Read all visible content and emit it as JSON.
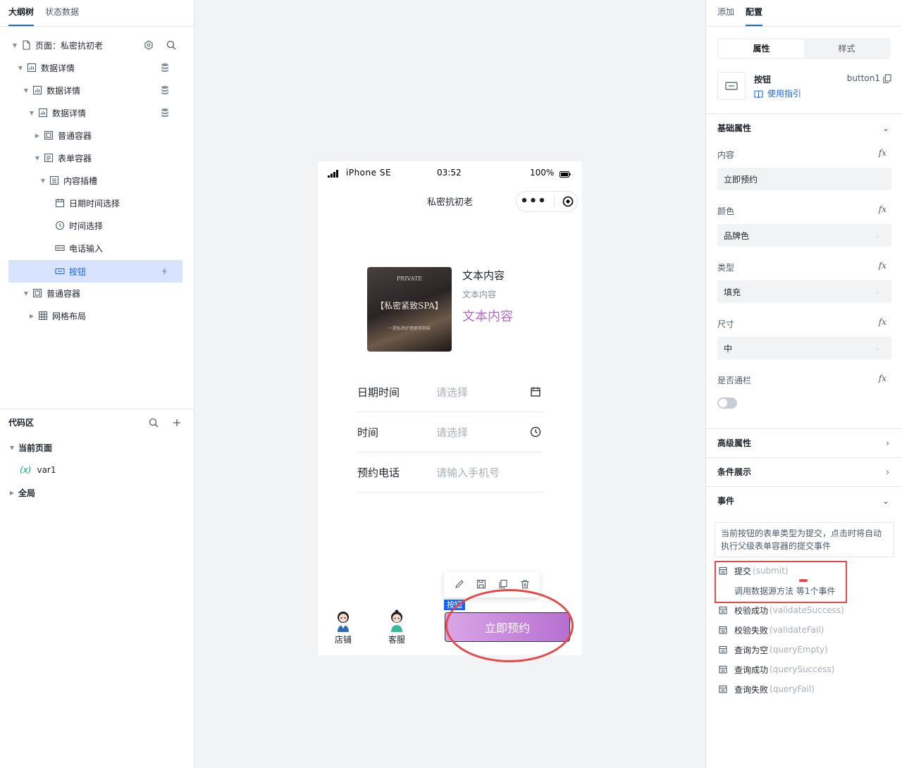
{
  "left": {
    "tabs": [
      "大纲树",
      "状态数据"
    ],
    "tree": [
      {
        "label": "页面：私密抗初老",
        "icon": "page-icon"
      },
      {
        "label": "数据详情",
        "icon": "chart-icon"
      },
      {
        "label": "数据详情",
        "icon": "chart-icon"
      },
      {
        "label": "数据详情",
        "icon": "chart-icon"
      },
      {
        "label": "普通容器",
        "icon": "container-icon"
      },
      {
        "label": "表单容器",
        "icon": "form-icon"
      },
      {
        "label": "内容插槽",
        "icon": "slot-icon"
      },
      {
        "label": "日期时间选择",
        "icon": "calendar-icon"
      },
      {
        "label": "时间选择",
        "icon": "clock-icon"
      },
      {
        "label": "电话输入",
        "icon": "input-icon"
      },
      {
        "label": "按钮",
        "icon": "button-icon"
      },
      {
        "label": "普通容器",
        "icon": "container-icon"
      },
      {
        "label": "网格布局",
        "icon": "grid-icon"
      }
    ],
    "code": {
      "title": "代码区",
      "current": "当前页面",
      "var_prefix": "(x)",
      "var": "var1",
      "global": "全局"
    }
  },
  "phone": {
    "device": "iPhone SE",
    "time": "03:52",
    "battery": "100%",
    "title": "私密抗初老",
    "image_text": "【私密紧致SPA】",
    "image_small_top": "PRIVATE",
    "image_small_sub": "一提私密护理更有韵味",
    "text1": "文本内容",
    "text2": "文本内容",
    "text3": "文本内容",
    "form": [
      {
        "label": "日期时间",
        "placeholder": "请选择",
        "icon": "calendar-icon"
      },
      {
        "label": "时间",
        "placeholder": "请选择",
        "icon": "clock-icon"
      },
      {
        "label": "预约电话",
        "placeholder": "请输入手机号",
        "icon": ""
      }
    ],
    "bottom": [
      "店铺",
      "客服"
    ],
    "button": "立即预约",
    "tag": "按钮"
  },
  "right": {
    "tabs": [
      "添加",
      "配置"
    ],
    "seg": [
      "属性",
      "样式"
    ],
    "component_name": "按钮",
    "component_id": "button1",
    "guide": "使用指引",
    "basic": "基础属性",
    "props": [
      {
        "label": "内容",
        "value": "立即预约"
      },
      {
        "label": "颜色",
        "value": "品牌色"
      },
      {
        "label": "类型",
        "value": "填充"
      },
      {
        "label": "尺寸",
        "value": "中"
      }
    ],
    "fx": "fx",
    "fullwidth": "是否通栏",
    "advanced": "高级属性",
    "condition": "条件展示",
    "events_title": "事件",
    "note": "当前按钮的表单类型为提交，点击时将自动执行父级表单容器的提交事件",
    "events": [
      {
        "name": "提交",
        "en": "(submit)"
      },
      {
        "name": "校验成功",
        "en": "(validateSuccess)"
      },
      {
        "name": "校验失败",
        "en": "(validateFail)"
      },
      {
        "name": "查询为空",
        "en": "(queryEmpty)"
      },
      {
        "name": "查询成功",
        "en": "(querySuccess)"
      },
      {
        "name": "查询失败",
        "en": "(queryFail)"
      }
    ],
    "submit_detail": "调用数据源方法 等1个事件"
  },
  "colors": {
    "brand": "#1664ff",
    "highlight": "#e84848",
    "purple_text": "#b36ad1"
  }
}
